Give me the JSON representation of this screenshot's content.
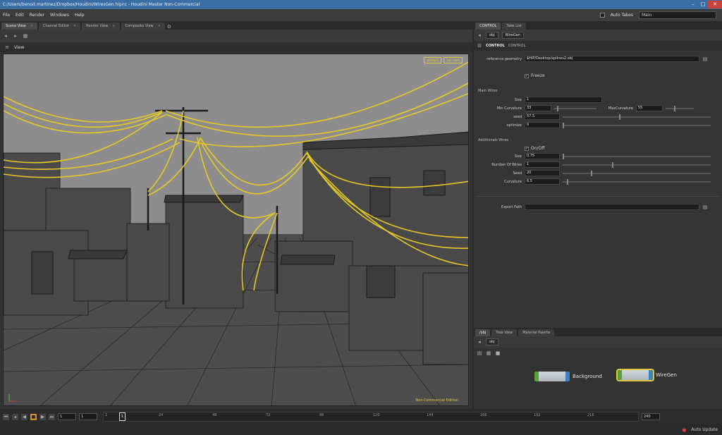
{
  "window": {
    "title": "C:/Users/benoit.martinez/Dropbox/Houdini/WiresGen.hipnc - Houdini Master Non-Commercial"
  },
  "menu": {
    "items": [
      "File",
      "Edit",
      "Render",
      "Windows",
      "Help"
    ],
    "auto_takes_label": "Auto Takes",
    "desktop_value": "Main"
  },
  "left_tabs": [
    {
      "label": "Scene View"
    },
    {
      "label": "Channel Editor"
    },
    {
      "label": "Render View"
    },
    {
      "label": "Composite View"
    }
  ],
  "viewport": {
    "header_label": "View",
    "camera_tag": "persp1",
    "camera_tag2": "no cam",
    "watermark": "Non-Commercial Edition"
  },
  "right_tabs": [
    {
      "label": "CONTROL"
    },
    {
      "label": "Take List"
    }
  ],
  "parm_pane": {
    "path_obj": "obj",
    "path_node": "WireGen",
    "control_label": "CONTROL",
    "control_name": "CONTROL",
    "reference_geometry_label": "reference geometry",
    "reference_geometry_value": "$HIP/Desktop/splines2.obj",
    "freeze_label": "Freeze",
    "main_wires_label": "Main Wires",
    "size_label": "Size",
    "size_value": "1",
    "min_curvature_label": "Min Curvature",
    "min_curvature_value": "33",
    "max_curvature_label": "MaxCurvature",
    "max_curvature_value": "55",
    "seed_label": "seed",
    "seed_value": "57.5",
    "optimize_label": "optimize",
    "optimize_value": "0",
    "additional_wires_label": "Additionals Wires",
    "onoff_label": "On/Off",
    "add_size_label": "Size",
    "add_size_value": "0.75",
    "number_of_wires_label": "Number Of Wires",
    "number_of_wires_value": "1",
    "seed2_label": "Seed",
    "seed2_value": "20",
    "curvature_label": "Curvature",
    "curvature_value": "6.5",
    "export_path_label": "Export Path"
  },
  "net_pane": {
    "tabs": [
      {
        "label": "/obj"
      },
      {
        "label": "Tree View"
      },
      {
        "label": "Material Palette"
      }
    ],
    "path_obj": "obj",
    "nodes": [
      {
        "label": "Background"
      },
      {
        "label": "WireGen"
      }
    ]
  },
  "timeline": {
    "current_frame": "1",
    "start_frame": "1",
    "end_frame": "240",
    "ticks": [
      "1",
      "24",
      "48",
      "72",
      "96",
      "120",
      "144",
      "168",
      "192",
      "216"
    ],
    "cursor_label": "1",
    "auto_update_label": "Auto Update"
  }
}
